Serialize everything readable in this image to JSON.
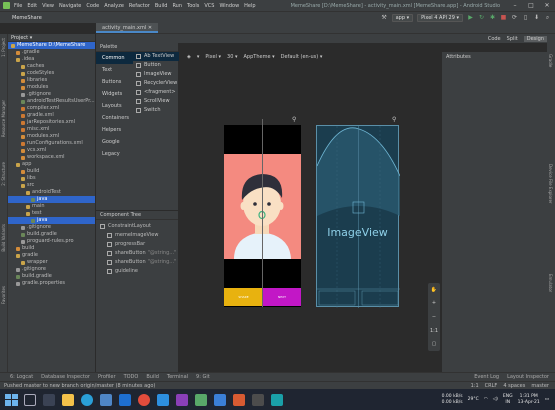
{
  "titlebar": {
    "menu": [
      "File",
      "Edit",
      "View",
      "Navigate",
      "Code",
      "Analyze",
      "Refactor",
      "Build",
      "Run",
      "Tools",
      "VCS",
      "Window",
      "Help"
    ],
    "window_title": "MemeShare [D:\\MemeShare] - activity_main.xml [MemeShare.app] - Android Studio",
    "minimize": "–",
    "maximize": "□",
    "close": "✕"
  },
  "navbar": {
    "project": "MemeShare",
    "run_config": "app ▾",
    "device": "Pixel 4 API 29 ▾"
  },
  "left_tabs": [
    "1: Project",
    "Resource Manager",
    "2: Structure",
    "Build Variants",
    "Favorites"
  ],
  "project_panel": {
    "title": "Project ▾",
    "items": [
      {
        "label": "MemeShare D:\\MemeShare",
        "indent": 0,
        "color": "#c9a44a",
        "selected": true
      },
      {
        "label": ".gradle",
        "indent": 1,
        "color": "#d38c3a"
      },
      {
        "label": ".idea",
        "indent": 1,
        "color": "#c9a44a"
      },
      {
        "label": "caches",
        "indent": 2,
        "color": "#c9a44a"
      },
      {
        "label": "codeStyles",
        "indent": 2,
        "color": "#c9a44a"
      },
      {
        "label": "libraries",
        "indent": 2,
        "color": "#d38c3a"
      },
      {
        "label": "modules",
        "indent": 2,
        "color": "#d38c3a"
      },
      {
        "label": ".gitignore",
        "indent": 2,
        "color": "#999999"
      },
      {
        "label": "androidTestResultsUserPr...",
        "indent": 2,
        "color": "#6a8759"
      },
      {
        "label": "compiler.xml",
        "indent": 2,
        "color": "#cc7832"
      },
      {
        "label": "gradle.xml",
        "indent": 2,
        "color": "#cc7832"
      },
      {
        "label": "jarRepositories.xml",
        "indent": 2,
        "color": "#cc7832"
      },
      {
        "label": "misc.xml",
        "indent": 2,
        "color": "#cc7832"
      },
      {
        "label": "modules.xml",
        "indent": 2,
        "color": "#d38c3a"
      },
      {
        "label": "runConfigurations.xml",
        "indent": 2,
        "color": "#cc7832"
      },
      {
        "label": "vcs.xml",
        "indent": 2,
        "color": "#d38c3a"
      },
      {
        "label": "workspace.xml",
        "indent": 2,
        "color": "#d38c3a"
      },
      {
        "label": "app",
        "indent": 1,
        "color": "#c9a44a"
      },
      {
        "label": "build",
        "indent": 2,
        "color": "#d38c3a"
      },
      {
        "label": "libs",
        "indent": 2,
        "color": "#c9a44a"
      },
      {
        "label": "src",
        "indent": 2,
        "color": "#c9a44a"
      },
      {
        "label": "androidTest",
        "indent": 3,
        "color": "#c9a44a"
      },
      {
        "label": "java",
        "indent": 4,
        "color": "#6a8759",
        "selected": true
      },
      {
        "label": "main",
        "indent": 3,
        "color": "#c9a44a"
      },
      {
        "label": "test",
        "indent": 3,
        "color": "#c9a44a"
      },
      {
        "label": "java",
        "indent": 4,
        "color": "#6a8759",
        "selected": true
      },
      {
        "label": ".gitignore",
        "indent": 2,
        "color": "#999999"
      },
      {
        "label": "build.gradle",
        "indent": 2,
        "color": "#6a8759"
      },
      {
        "label": "proguard-rules.pro",
        "indent": 2,
        "color": "#999999"
      },
      {
        "label": "build",
        "indent": 1,
        "color": "#d38c3a"
      },
      {
        "label": "gradle",
        "indent": 1,
        "color": "#c9a44a"
      },
      {
        "label": "wrapper",
        "indent": 2,
        "color": "#c9a44a"
      },
      {
        "label": ".gitignore",
        "indent": 1,
        "color": "#999999"
      },
      {
        "label": "build.gradle",
        "indent": 1,
        "color": "#6a8759"
      },
      {
        "label": "gradle.properties",
        "indent": 1,
        "color": "#999999"
      }
    ]
  },
  "editor_tabs": [
    {
      "label": "activity_main.xml ✕"
    }
  ],
  "mode_buttons": {
    "code": "Code",
    "split": "Split",
    "design": "Design"
  },
  "palette": {
    "title": "Palette",
    "categories": [
      "Common",
      "Text",
      "Buttons",
      "Widgets",
      "Layouts",
      "Containers",
      "Helpers",
      "Google",
      "Legacy"
    ],
    "items": [
      "Ab TextView",
      "Button",
      "ImageView",
      "RecyclerView",
      "<fragment>",
      "ScrollView",
      "Switch"
    ]
  },
  "component_tree": {
    "title": "Component Tree",
    "items": [
      {
        "label": "ConstraintLayout",
        "indent": 0
      },
      {
        "label": "memeImageView",
        "indent": 1
      },
      {
        "label": "progressBar",
        "indent": 1
      },
      {
        "label": "shareButton",
        "indent": 1,
        "extra": "\"@string...\"",
        "error": true
      },
      {
        "label": "shareButton",
        "indent": 1,
        "extra": "\"@string...\"",
        "error": true
      },
      {
        "label": "guideline",
        "indent": 1
      }
    ]
  },
  "design_toolbar": {
    "orientation": "▾",
    "device": "Pixel ▾",
    "api": "30 ▾",
    "theme": "AppTheme ▾",
    "locale": "Default (en-us) ▾"
  },
  "preview": {
    "button1": "SHARE",
    "button2": "NEXT",
    "blueprint_label": "ImageView",
    "colors": {
      "background": "#f48a80",
      "share": "#e8b20f",
      "next": "#c217c6"
    }
  },
  "zoom_controls": [
    "✋",
    "+",
    "−",
    "1:1",
    "▢"
  ],
  "attributes": {
    "title": "Attributes"
  },
  "right_tabs": [
    "Gradle",
    "Device File Explorer",
    "Emulator"
  ],
  "bottom_tabs": {
    "left": [
      "6: Logcat",
      "Database Inspector",
      "Profiler",
      "TODO",
      "Build",
      "Terminal",
      "9: Git"
    ],
    "right": [
      "Event Log",
      "Layout Inspector"
    ]
  },
  "status": {
    "message": "Pushed master to new branch origin/master (8 minutes ago)",
    "position": "1:1",
    "encoding": "CRLF",
    "indent": "4 spaces",
    "branch": "master"
  },
  "taskbar": {
    "temp": "29°C",
    "net_up": "0.00 kB/s",
    "net_down": "0.00 kB/s",
    "lang_top": "ENG",
    "lang_bottom": "IN",
    "time": "1:31 PM",
    "date": "13-Apr-21"
  }
}
